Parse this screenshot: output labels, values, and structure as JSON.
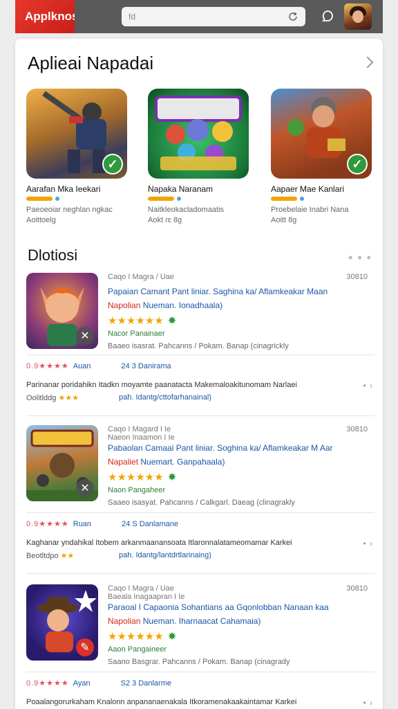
{
  "header": {
    "brand": "Applknosai",
    "search_placeholder": "fd",
    "search_icon": "refresh-icon",
    "chat_icon": "chat-icon"
  },
  "section1": {
    "title": "Aplieai Napadai",
    "featured": [
      {
        "name": "Aarafan Mka Ieekari",
        "desc1": "Paeoeoiar neghlan ngkac",
        "desc2": "Aoittoelg"
      },
      {
        "name": "Napaka Naranam",
        "desc1": "Naitkleokacladomaatis",
        "desc2": "Aokt ɾɛ 8g"
      },
      {
        "name": "Aapaer Mae Kanlari",
        "desc1": "Proebelaie Inabri Nana",
        "desc2": "Aoitt 8g"
      }
    ]
  },
  "section2": {
    "title": "Dlotiosi",
    "more": "• • •",
    "entries": [
      {
        "meta": "Caqo I Magra / Uae",
        "num": "30810",
        "line1": "Papaian Camant Pant liniar. Saghina ka/ Aflamkeakar Maan",
        "line2_red": "Napolian",
        "line2_blue": "Nueman. Ionadhaala)",
        "stars": "★★★★★★",
        "developer": "Nacor Panainaer",
        "category": "Baaeo isasrat. Pahcanns / Pokam. Banap (cinagrickly",
        "rating_stars": "0.9★★★★",
        "rating_label": "Auan",
        "count_label": "24 3 Danirama",
        "comment1": "Parinanar poridahikn  Itadkn moyamte paanatacta  Makemaloakitunomam Narlaei",
        "comment2_left": "Oolitlddg",
        "comment2_stars": "★★★",
        "comment2_right": "pah. Idantg/cttofarhanainal)"
      },
      {
        "meta": "Caqo I Magard I Ie",
        "num": "30810",
        "meta2": "Naeon Inaamon I Ie",
        "line1": "Pabaolan Camaai Pant liniar. Soghina ka/ Aflamkeakar M Aar",
        "line2_red": "Napaliet",
        "line2_blue": "Nuemart. Ganpahaala)",
        "stars": "★★★★★★",
        "developer": "Naon Pangaheer",
        "category": "Saaeo isasyat. Pahcanns / Calkgarl. Daeag (clinagrakly",
        "rating_stars": "0.9★★★★",
        "rating_label": "Ruan",
        "count_label": "24 S Danlamane",
        "comment1": "Kaghanar yndahikal  Itobem arkanmaanansoata  Itlaronnalatameomamar Karkei",
        "comment2_left": "Beotltdpo",
        "comment2_stars": "★★",
        "comment2_right": "pah. Idantg/lantdrtlarinaing)"
      },
      {
        "meta": "Caqo I Magra / Uae",
        "num": "30810",
        "meta2": "Baeala Inagaapran I Ie",
        "line1": "Paraoal I Capaonia Sohantians aa Gqonlobban Nanaan kaa",
        "line2_red": "Napolian",
        "line2_blue": "Nueman. Iharnaacat Cahamaia)",
        "stars": "★★★★★★",
        "developer": "Aaon Pangaineer",
        "category": "Saano Basgrar. Pahcanns / Pokam. Banap (cinagrady",
        "rating_stars": "0.9★★★★",
        "rating_label": "Ayan",
        "count_label": "S2 3 Danlarme",
        "comment1": "Poaalangorurkaham  Knalonn anpananaenakala  Itkoramenakaakaintamar Karkei"
      }
    ]
  },
  "colors": {
    "brand_red": "#e8382b",
    "link_blue": "#1a55a6",
    "star_gold": "#f0a500",
    "badge_green": "#2e9a3a"
  }
}
